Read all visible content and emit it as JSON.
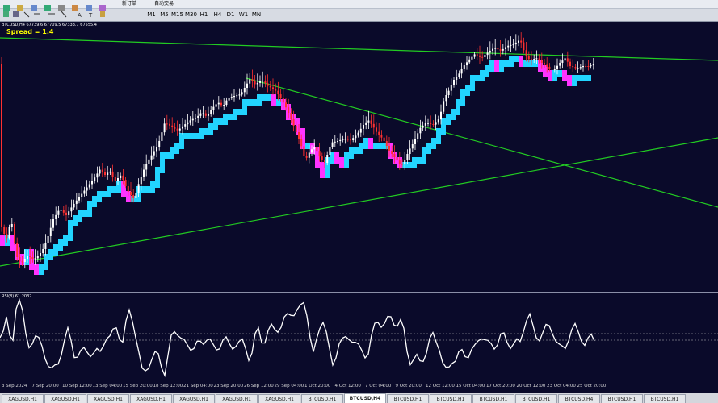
{
  "toolbar": {
    "new_order_label": "新订单",
    "autotrade_label": "自动交易",
    "timeframes": [
      "M1",
      "M5",
      "M15",
      "M30",
      "H1",
      "H4",
      "D1",
      "W1",
      "MN"
    ]
  },
  "chart": {
    "symbol_info": "BTCUSD,H4  67739.6  67709.5  67333.7  67555.4",
    "spread": "Spread = 1.4"
  },
  "rsi": {
    "label": "RSI(8) 61.2032"
  },
  "time_axis": [
    "3 Sep 2024",
    "7 Sep 20:00",
    "10 Sep 12:00",
    "13 Sep 04:00",
    "15 Sep 20:00",
    "18 Sep 12:00",
    "21 Sep 04:00",
    "23 Sep 20:00",
    "26 Sep 12:00",
    "29 Sep 04:00",
    "1 Oct 20:00",
    "4 Oct 12:00",
    "7 Oct 04:00",
    "9 Oct 20:00",
    "12 Oct 12:00",
    "15 Oct 04:00",
    "17 Oct 20:00",
    "20 Oct 12:00",
    "23 Oct 04:00",
    "25 Oct 20:00"
  ],
  "tabs": [
    "XAGUSD,H1",
    "XAGUSD,H1",
    "XAGUSD,H1",
    "XAGUSD,H1",
    "XAGUSD,H1",
    "XAGUSD,H1",
    "XAGUSD,H1",
    "BTCUSD,H1",
    "BTCUSD,H4",
    "BTCUSD,H1",
    "BTCUSD,H1",
    "BTCUSD,H1",
    "BTCUSD,H1",
    "BTCUSD,H4",
    "BTCUSD,H1",
    "BTCUSD,H1"
  ],
  "active_tab_index": 8,
  "colors": {
    "background": "#0a0a2a",
    "bull_candle": "#ffffff",
    "bear_candle": "#ff3030",
    "cloud_up": "#22d4ff",
    "cloud_down": "#ff33ff",
    "trendline": "#22cc22",
    "rsi_line": "#ffffff",
    "level_line": "#c0c0c0"
  }
}
